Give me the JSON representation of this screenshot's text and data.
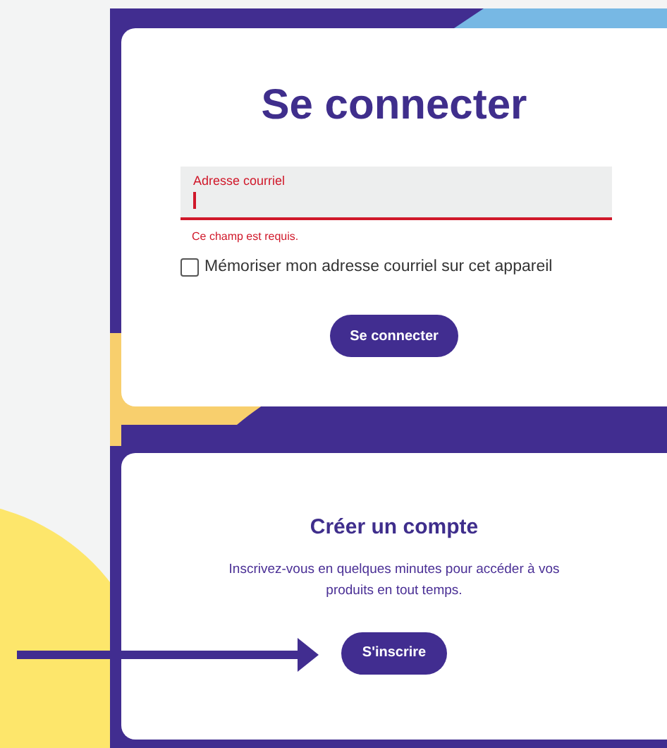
{
  "login_card": {
    "title": "Se connecter",
    "email_field": {
      "label": "Adresse courriel",
      "invalid": true,
      "error": "Ce champ est requis."
    },
    "remember": {
      "label": "Mémoriser mon adresse courriel sur cet appareil",
      "checked": false
    },
    "button": "Se connecter"
  },
  "signup_card": {
    "title": "Créer un compte",
    "text": "Inscrivez-vous en quelques minutes pour accéder à vos produits en tout temps.",
    "button": "S'inscrire"
  }
}
